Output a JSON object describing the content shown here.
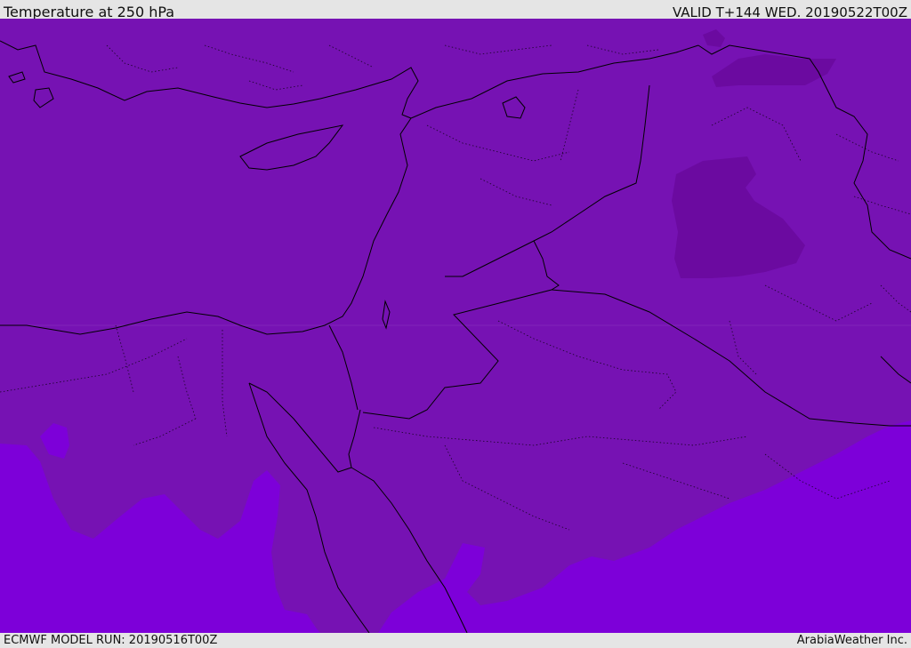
{
  "header": {
    "title": "Temperature at 250 hPa",
    "valid": "VALID T+144 WED. 20190522T00Z"
  },
  "footer": {
    "model_run": "ECMWF MODEL RUN: 20190516T00Z",
    "credit": "ArabiaWeather Inc."
  },
  "colors": {
    "band_base": "#7612b3",
    "band_cold_core": "#6b0aa0",
    "band_warm": "#7d00d9",
    "frame_bg": "#e5e5e5",
    "border_line": "#000000",
    "gridline": "#9a4fc8"
  }
}
